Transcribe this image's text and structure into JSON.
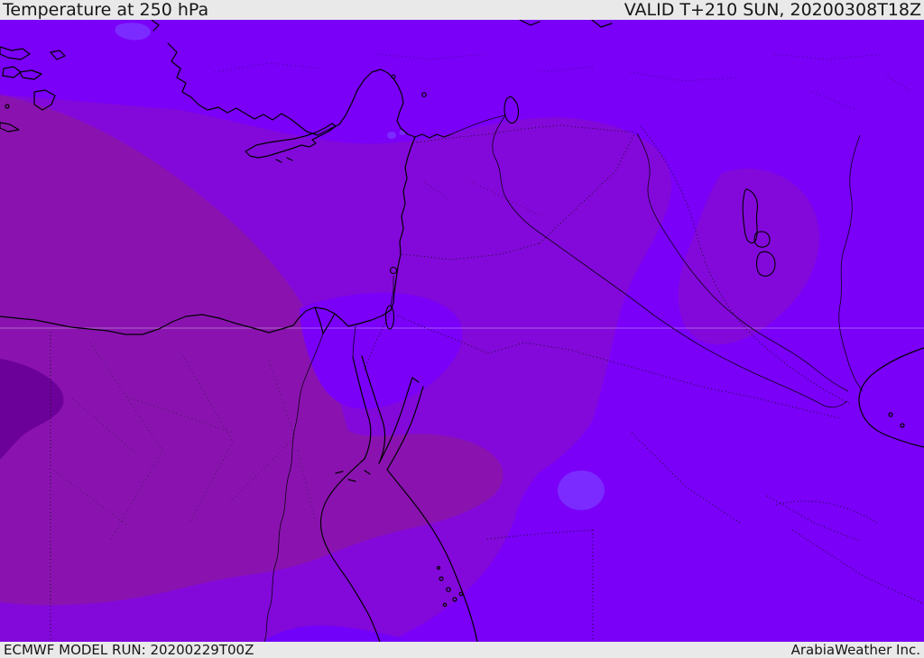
{
  "header": {
    "left": "Temperature at 250 hPa",
    "right": "VALID T+210 SUN, 20200308T18Z"
  },
  "footer": {
    "left": "ECMWF MODEL RUN: 20200229T00Z",
    "right": "ArabiaWeather Inc."
  },
  "map": {
    "colors": {
      "bar_bg": "#e9e9e9",
      "bar_text": "#161616",
      "band_bright_violet": "#7a00f8",
      "band_muted_violet": "#8309da",
      "band_medium_purple": "#8a13b0",
      "band_dark_purple": "#6c019a",
      "band_blue_violet": "#7b2bff",
      "band_blue_violet_deep": "#7201fa",
      "gridline": "rgba(255,255,255,0.35)"
    }
  }
}
